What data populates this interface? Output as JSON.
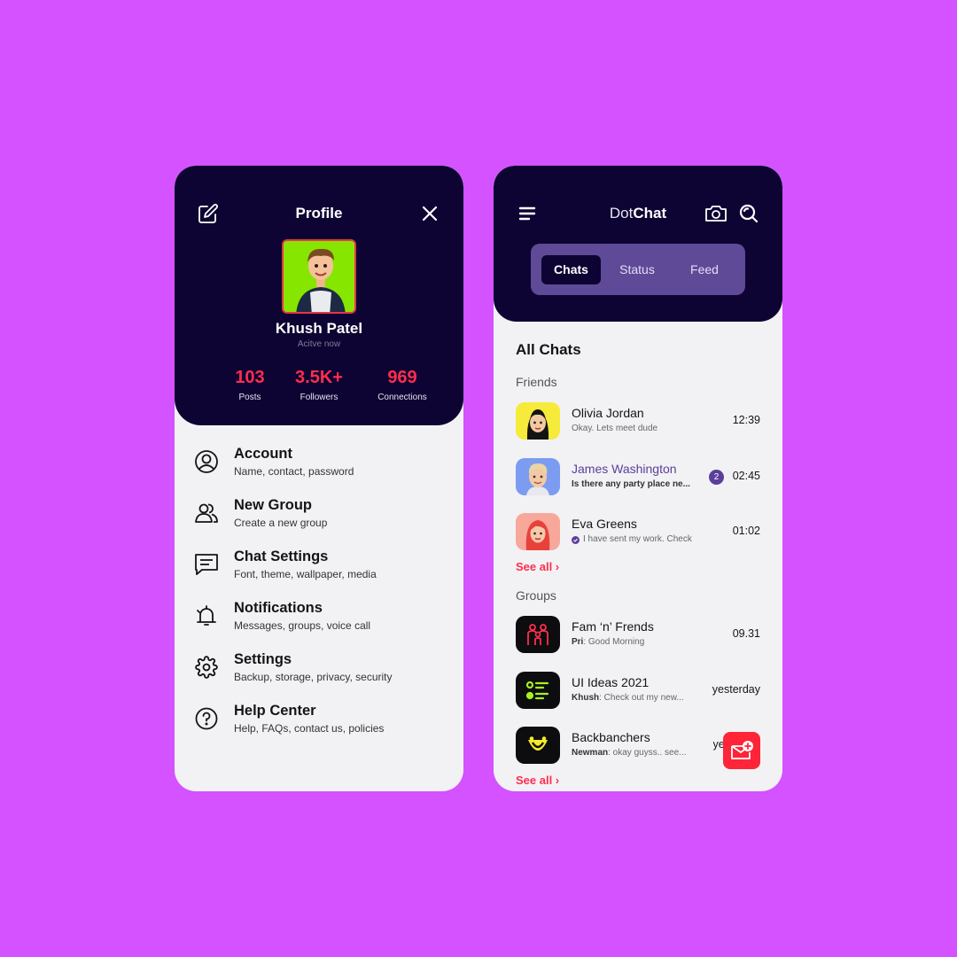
{
  "profile": {
    "title": "Profile",
    "name": "Khush Patel",
    "status": "Acitve now",
    "stats": [
      {
        "value": "103",
        "label": "Posts"
      },
      {
        "value": "3.5K+",
        "label": "Followers"
      },
      {
        "value": "969",
        "label": "Connections"
      }
    ],
    "menu": [
      {
        "title": "Account",
        "subtitle": "Name, contact, password",
        "icon": "user-icon"
      },
      {
        "title": "New Group",
        "subtitle": "Create a new group",
        "icon": "group-icon"
      },
      {
        "title": "Chat Settings",
        "subtitle": "Font, theme, wallpaper, media",
        "icon": "chat-icon"
      },
      {
        "title": "Notifications",
        "subtitle": "Messages, groups, voice call",
        "icon": "bell-icon"
      },
      {
        "title": "Settings",
        "subtitle": "Backup, storage, privacy, security",
        "icon": "gear-icon"
      },
      {
        "title": "Help Center",
        "subtitle": "Help, FAQs, contact us, policies",
        "icon": "help-icon"
      }
    ]
  },
  "chat": {
    "app_title_light": "Dot",
    "app_title_bold": "Chat",
    "tabs": [
      "Chats",
      "Status",
      "Feed"
    ],
    "active_tab": "Chats",
    "section_title": "All Chats",
    "friends_label": "Friends",
    "groups_label": "Groups",
    "see_all": "See all ›",
    "friends": [
      {
        "name": "Olivia Jordan",
        "message": "Okay. Lets meet dude",
        "time": "12:39"
      },
      {
        "name": "James Washington",
        "message": "Is there any party place ne...",
        "time": "02:45",
        "unread": "2"
      },
      {
        "name": "Eva Greens",
        "message": "I have sent my work. Check",
        "time": "01:02"
      }
    ],
    "groups": [
      {
        "name": "Fam ‘n’ Frends",
        "sender": "Pri",
        "message": ": Good Morning",
        "time": "09.31"
      },
      {
        "name": "UI Ideas 2021",
        "sender": "Khush",
        "message": ": Check out my new...",
        "time": "yesterday"
      },
      {
        "name": "Backbanchers",
        "sender": "Newman",
        "message": ": okay guyss.. see...",
        "time": "yes"
      }
    ]
  },
  "colors": {
    "background": "#d452ff",
    "header": "#0d0433",
    "accent_red": "#ff2d4d",
    "tab_bar": "#5e4a96",
    "avatar_green": "#86e600"
  }
}
